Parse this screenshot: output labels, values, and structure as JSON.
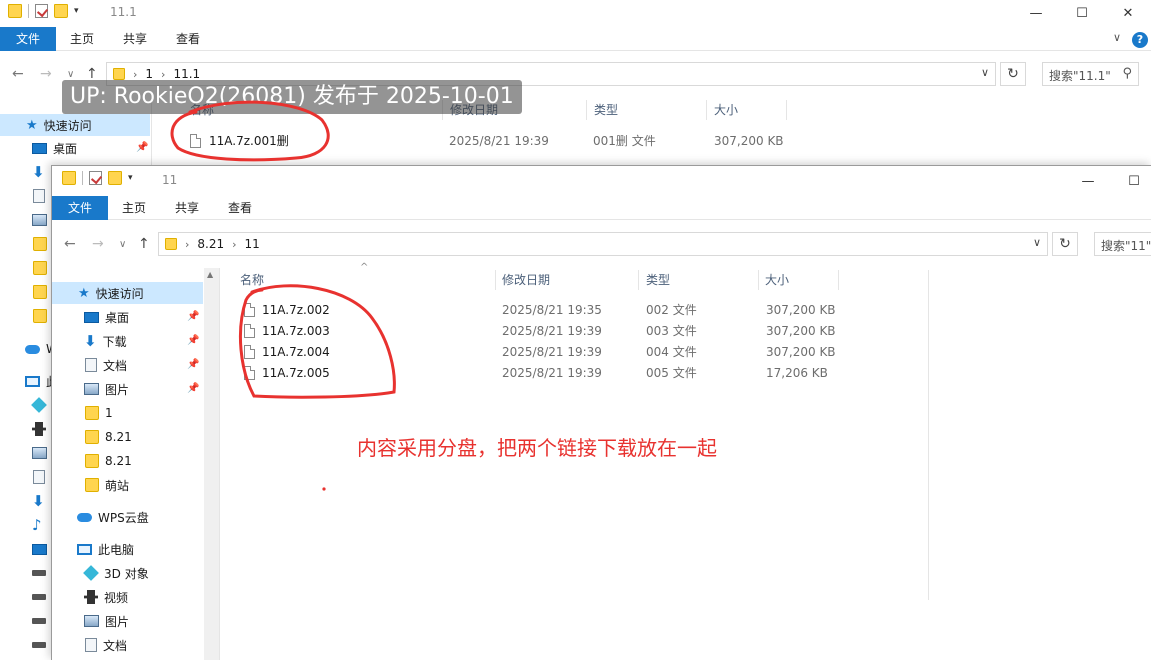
{
  "watermark": "UP: RookieO2(26081) 发布于 2025-10-01",
  "annotation": "内容采用分盘，把两个链接下载放在一起",
  "back_window": {
    "title": "11.1",
    "ribbon_tabs": [
      "文件",
      "主页",
      "共享",
      "查看"
    ],
    "breadcrumb": [
      "1",
      "11.1"
    ],
    "search_placeholder": "搜索\"11.1\"",
    "columns": {
      "name": "名称",
      "date": "修改日期",
      "type": "类型",
      "size": "大小"
    },
    "sidebar": {
      "quick_access": "快速访问",
      "desktop": "桌面",
      "wps_cloud_partial": "W",
      "this_pc_partial": "此"
    },
    "files": [
      {
        "name": "11A.7z.001删",
        "date": "2025/8/21 19:39",
        "type": "001删 文件",
        "size": "307,200 KB"
      }
    ]
  },
  "front_window": {
    "title": "11",
    "ribbon_tabs": [
      "文件",
      "主页",
      "共享",
      "查看"
    ],
    "breadcrumb": [
      "8.21",
      "11"
    ],
    "search_placeholder": "搜索\"11\"",
    "columns": {
      "name": "名称",
      "date": "修改日期",
      "type": "类型",
      "size": "大小"
    },
    "sidebar": {
      "quick_access": "快速访问",
      "pinned": [
        "桌面",
        "下载",
        "文档",
        "图片"
      ],
      "folders": [
        "1",
        "8.21",
        "8.21",
        "萌站"
      ],
      "wps_cloud": "WPS云盘",
      "this_pc": "此电脑",
      "pc_items": [
        "3D 对象",
        "视频",
        "图片",
        "文档"
      ]
    },
    "files": [
      {
        "name": "11A.7z.002",
        "date": "2025/8/21 19:35",
        "type": "002 文件",
        "size": "307,200 KB"
      },
      {
        "name": "11A.7z.003",
        "date": "2025/8/21 19:39",
        "type": "003 文件",
        "size": "307,200 KB"
      },
      {
        "name": "11A.7z.004",
        "date": "2025/8/21 19:39",
        "type": "004 文件",
        "size": "307,200 KB"
      },
      {
        "name": "11A.7z.005",
        "date": "2025/8/21 19:39",
        "type": "005 文件",
        "size": "17,206 KB"
      }
    ]
  },
  "colors": {
    "accent": "#1979ca",
    "annotation": "#e8322f",
    "selection": "#cce8ff"
  }
}
